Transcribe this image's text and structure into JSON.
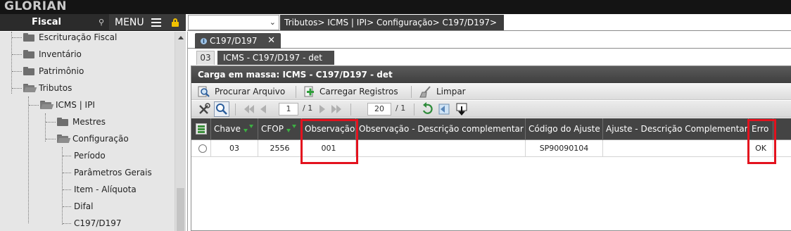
{
  "app": {
    "brand": "GLORIAN"
  },
  "left_header": {
    "module": "Fiscal",
    "menu_label": "MENU"
  },
  "right_header": {
    "route_value": "",
    "breadcrumb": "Tributos> ICMS | IPI> Configuração> C197/D197>"
  },
  "sidebar": {
    "items": [
      {
        "label": "Escrituração Fiscal"
      },
      {
        "label": "Inventário"
      },
      {
        "label": "Patrimônio"
      },
      {
        "label": "Tributos"
      },
      {
        "label": "ICMS | IPI"
      },
      {
        "label": "Mestres"
      },
      {
        "label": "Configuração"
      },
      {
        "label": "Período"
      },
      {
        "label": "Parâmetros Gerais"
      },
      {
        "label": "Item - Alíquota"
      },
      {
        "label": "Difal"
      },
      {
        "label": "C197/D197"
      }
    ]
  },
  "main_tab": {
    "label": "C197/D197",
    "close": "✕"
  },
  "subtab": {
    "number": "03",
    "title": "ICMS - C197/D197 - det"
  },
  "panel": {
    "title": "Carga em massa: ICMS - C197/D197 - det",
    "actions": {
      "browse": "Procurar Arquivo",
      "load": "Carregar Registros",
      "clear": "Limpar"
    }
  },
  "pager": {
    "page": "1",
    "of_pages": "/ 1",
    "rows_per_page": "20",
    "of_total": "/ 1"
  },
  "grid": {
    "columns": [
      "Chave",
      "CFOP",
      "Observação",
      "Observação - Descrição complementar",
      "Código do Ajuste",
      "Ajuste - Descrição Complementar",
      "Erro"
    ],
    "rows": [
      {
        "chave": "03",
        "cfop": "2556",
        "observacao": "001",
        "obs_desc": "",
        "codigo_ajuste": "SP90090104",
        "ajuste_desc": "",
        "erro": "OK"
      }
    ]
  },
  "colors": {
    "highlight": "#e3121e",
    "header_dark": "#444444",
    "filter_green": "#3cb043"
  }
}
